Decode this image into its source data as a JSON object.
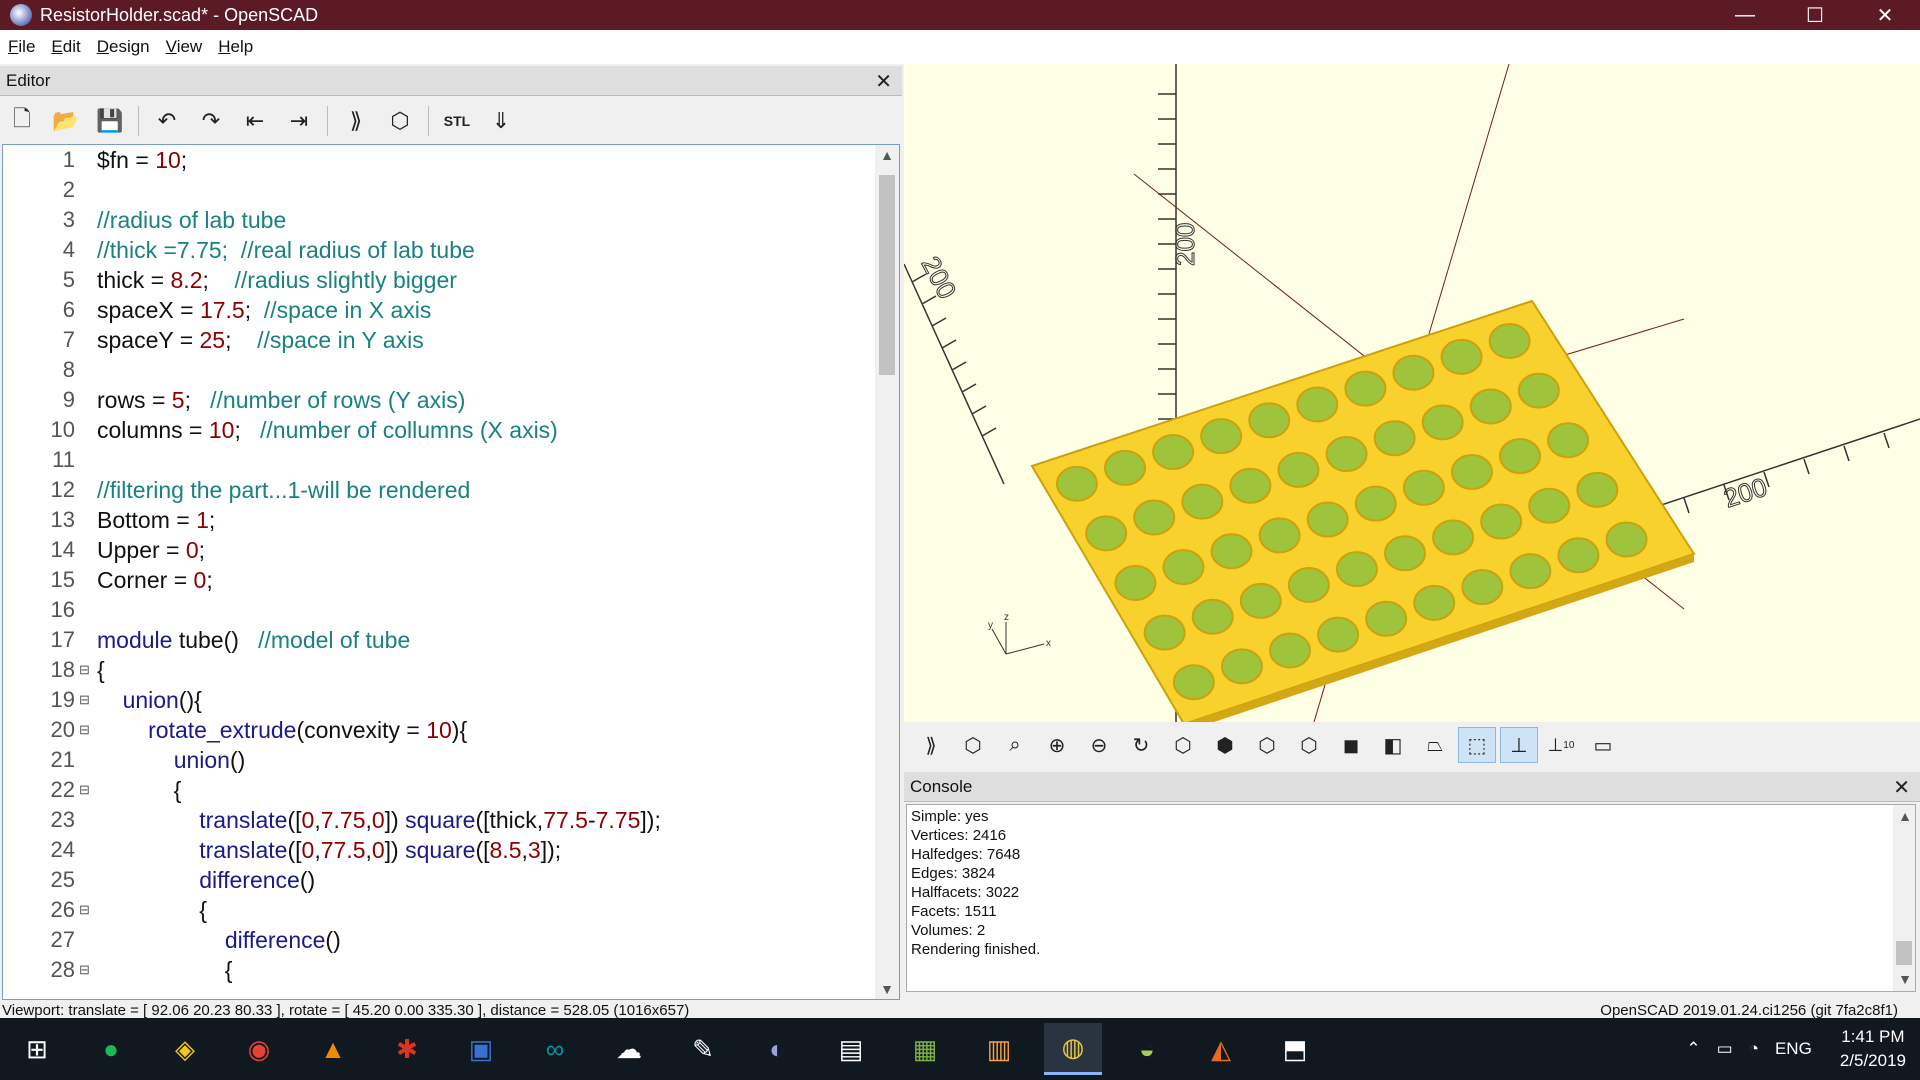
{
  "window": {
    "title": "ResistorHolder.scad* - OpenSCAD"
  },
  "menu": [
    "File",
    "Edit",
    "Design",
    "View",
    "Help"
  ],
  "editor": {
    "title": "Editor",
    "toolbar": [
      "new-icon",
      "open-icon",
      "save-icon",
      "undo-icon",
      "redo-icon",
      "unindent-icon",
      "indent-icon",
      "preview-icon",
      "render-icon",
      "export-stl-icon",
      "send-to-print-icon"
    ],
    "stl_label": "STL",
    "lines": [
      {
        "n": "1",
        "fold": "",
        "t": "$fn = 10;"
      },
      {
        "n": "2",
        "fold": "",
        "t": ""
      },
      {
        "n": "3",
        "fold": "",
        "t": "//radius of lab tube"
      },
      {
        "n": "4",
        "fold": "",
        "t": "//thick =7.75;  //real radius of lab tube"
      },
      {
        "n": "5",
        "fold": "",
        "t": "thick = 8.2;    //radius slightly bigger"
      },
      {
        "n": "6",
        "fold": "",
        "t": "spaceX = 17.5;  //space in X axis"
      },
      {
        "n": "7",
        "fold": "",
        "t": "spaceY = 25;    //space in Y axis"
      },
      {
        "n": "8",
        "fold": "",
        "t": ""
      },
      {
        "n": "9",
        "fold": "",
        "t": "rows = 5;   //number of rows (Y axis)"
      },
      {
        "n": "10",
        "fold": "",
        "t": "columns = 10;   //number of collumns (X axis)"
      },
      {
        "n": "11",
        "fold": "",
        "t": ""
      },
      {
        "n": "12",
        "fold": "",
        "t": "//filtering the part...1-will be rendered"
      },
      {
        "n": "13",
        "fold": "",
        "t": "Bottom = 1;"
      },
      {
        "n": "14",
        "fold": "",
        "t": "Upper = 0;"
      },
      {
        "n": "15",
        "fold": "",
        "t": "Corner = 0;"
      },
      {
        "n": "16",
        "fold": "",
        "t": ""
      },
      {
        "n": "17",
        "fold": "",
        "t": "module tube()   //model of tube"
      },
      {
        "n": "18",
        "fold": "⊟",
        "t": "{"
      },
      {
        "n": "19",
        "fold": "⊟",
        "t": "    union(){"
      },
      {
        "n": "20",
        "fold": "⊟",
        "t": "        rotate_extrude(convexity = 10){"
      },
      {
        "n": "21",
        "fold": "",
        "t": "            union()"
      },
      {
        "n": "22",
        "fold": "⊟",
        "t": "            {"
      },
      {
        "n": "23",
        "fold": "",
        "t": "                translate([0,7.75,0]) square([thick,77.5-7.75]);"
      },
      {
        "n": "24",
        "fold": "",
        "t": "                translate([0,77.5,0]) square([8.5,3]);"
      },
      {
        "n": "25",
        "fold": "",
        "t": "                difference()"
      },
      {
        "n": "26",
        "fold": "⊟",
        "t": "                {"
      },
      {
        "n": "27",
        "fold": "",
        "t": "                    difference()"
      },
      {
        "n": "28",
        "fold": "⊟",
        "t": "                    {"
      }
    ]
  },
  "viewport": {
    "axis_labels": [
      "200",
      "200",
      "200"
    ],
    "small_axes": [
      "x",
      "y",
      "z"
    ],
    "model_color": "#f9d12d",
    "toolbar": [
      "preview-icon",
      "render-icon",
      "view-all-icon",
      "zoom-in-icon",
      "zoom-out-icon",
      "reset-view-icon",
      "view-right-icon",
      "view-top-icon",
      "view-bottom-icon",
      "view-left-icon",
      "view-front-icon",
      "view-back-icon",
      "perspective-icon",
      "orthogonal-icon",
      "show-axes-icon",
      "show-scale-icon",
      "show-edges-icon"
    ],
    "scale_marker": "10"
  },
  "console": {
    "title": "Console",
    "lines": [
      "Simple: yes",
      "Vertices: 2416",
      "Halfedges: 7648",
      "Edges: 3824",
      "Halffacets: 3022",
      "Facets: 1511",
      "Volumes: 2",
      "Rendering finished."
    ]
  },
  "status": {
    "left": "Viewport: translate = [ 92.06 20.23 80.33 ], rotate = [ 45.20 0.00 335.30 ], distance = 528.05 (1016x657)",
    "right": "OpenSCAD 2019.01.24.ci1256 (git 7fa2c8f1)"
  },
  "taskbar": {
    "apps": [
      "windows-start-icon",
      "spotify-icon",
      "lightbulb-app-icon",
      "chrome-icon",
      "vlc-icon",
      "app-red-icon",
      "save-disk-icon",
      "arduino-icon",
      "app-icon",
      "app-icon-2",
      "eclipse-icon",
      "app-icon-3",
      "app-icon-4",
      "app-icon-5",
      "openscad-icon",
      "app-icon-6",
      "matlab-icon",
      "app-icon-7"
    ],
    "lang": "ENG",
    "time": "1:41 PM",
    "date": "2/5/2019"
  }
}
